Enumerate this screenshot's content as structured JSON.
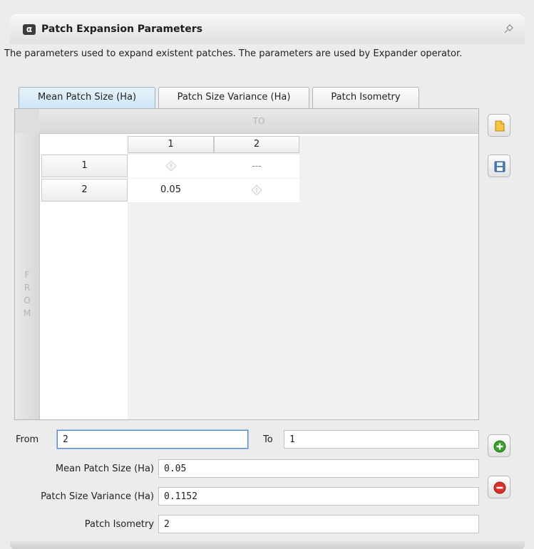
{
  "panel": {
    "badge": "α",
    "title": "Patch Expansion Parameters",
    "pin_icon": "pin-icon",
    "description": "The parameters used to expand existent patches. The parameters are used by Expander operator."
  },
  "tabs": [
    {
      "label": "Mean Patch Size (Ha)",
      "active": true
    },
    {
      "label": "Patch Size Variance (Ha)",
      "active": false
    },
    {
      "label": "Patch Isometry",
      "active": false
    }
  ],
  "matrix": {
    "to_label": "TO",
    "from_letters": [
      "F",
      "R",
      "O",
      "M"
    ],
    "column_headers": [
      "1",
      "2"
    ],
    "row_headers": [
      "1",
      "2"
    ],
    "cells": [
      [
        "",
        "---"
      ],
      [
        "0.05",
        ""
      ]
    ],
    "empty_cell_icon": "warning-diamond-icon"
  },
  "side_buttons": {
    "open_icon": "folder-open-icon",
    "save_icon": "floppy-save-icon",
    "add_icon": "plus-circle-icon",
    "remove_icon": "minus-circle-icon"
  },
  "form": {
    "from_label": "From",
    "from_value": "2",
    "to_label": "To",
    "to_value": "1",
    "mean_label": "Mean Patch Size (Ha)",
    "mean_value": "0.05",
    "variance_label": "Patch Size Variance (Ha)",
    "variance_value": "0.1152",
    "isometry_label": "Patch Isometry",
    "isometry_value": "2"
  },
  "colors": {
    "active_tab": "#cfe6f6",
    "add_button": "#3aa02b",
    "remove_button": "#d8302a",
    "focus_border": "#4f8cc9"
  }
}
